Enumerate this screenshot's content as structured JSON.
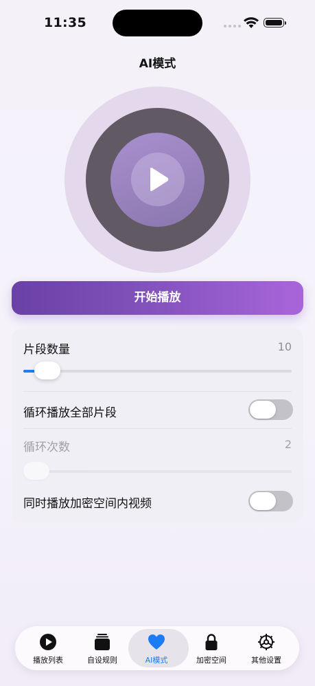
{
  "status_bar": {
    "time": "11:35"
  },
  "page": {
    "title": "AI模式"
  },
  "player": {
    "start_button_label": "开始播放"
  },
  "settings": {
    "segment_count": {
      "label": "片段数量",
      "value": "10",
      "slider_level": 0.09
    },
    "loop_all": {
      "label": "循环播放全部片段",
      "on": false
    },
    "loop_times": {
      "label": "循环次数",
      "value": "2",
      "slider_level": 0.02
    },
    "play_encrypted": {
      "label": "同时播放加密空间内视频",
      "on": false
    }
  },
  "tabs": [
    {
      "label": "播放列表",
      "icon": "play-circle-icon",
      "active": false
    },
    {
      "label": "自设规则",
      "icon": "stack-icon",
      "active": false
    },
    {
      "label": "AI模式",
      "icon": "heart-icon",
      "active": true
    },
    {
      "label": "加密空间",
      "icon": "lock-icon",
      "active": false
    },
    {
      "label": "其他设置",
      "icon": "gear-icon",
      "active": false
    }
  ],
  "colors": {
    "accent": "#1c7cf5",
    "button_start": "#6a41a6",
    "button_end": "#a865da"
  }
}
